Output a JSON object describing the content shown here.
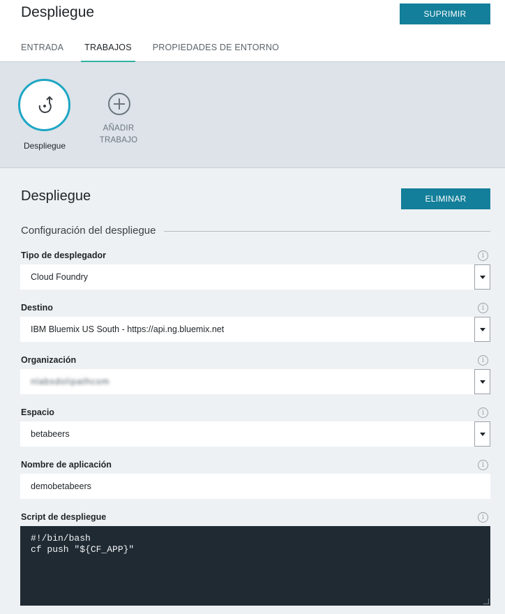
{
  "header": {
    "title": "Despliegue",
    "delete_stage_label": "SUPRIMIR",
    "tabs": [
      {
        "label": "ENTRADA",
        "active": false
      },
      {
        "label": "TRABAJOS",
        "active": true
      },
      {
        "label": "PROPIEDADES DE ENTORNO",
        "active": false
      }
    ]
  },
  "jobs": {
    "current_job_label": "Despliegue",
    "add_job_line1": "AÑADIR",
    "add_job_line2": "TRABAJO"
  },
  "job_detail": {
    "title": "Despliegue",
    "delete_job_label": "ELIMINAR",
    "section_heading": "Configuración del despliegue",
    "fields": {
      "deployer_type": {
        "label": "Tipo de desplegador",
        "value": "Cloud Foundry"
      },
      "target": {
        "label": "Destino",
        "value": "IBM Bluemix US South - https://api.ng.bluemix.net"
      },
      "organization": {
        "label": "Organización",
        "value": "nlabsdolipathcom"
      },
      "space": {
        "label": "Espacio",
        "value": "betabeers"
      },
      "app_name": {
        "label": "Nombre de aplicación",
        "value": "demobetabeers"
      },
      "script": {
        "label": "Script de despliegue",
        "value": "#!/bin/bash\ncf push \"${CF_APP}\""
      }
    }
  },
  "colors": {
    "accent": "#137f9a",
    "active_tab_underline": "#2fb2a0",
    "job_ring": "#1ea6c4",
    "script_bg": "#1f2a33"
  },
  "icons": {
    "info": "info-icon",
    "add_job": "plus-circle-icon",
    "deploy_job": "deploy-arrow-icon",
    "dropdown": "caret-down-icon"
  }
}
